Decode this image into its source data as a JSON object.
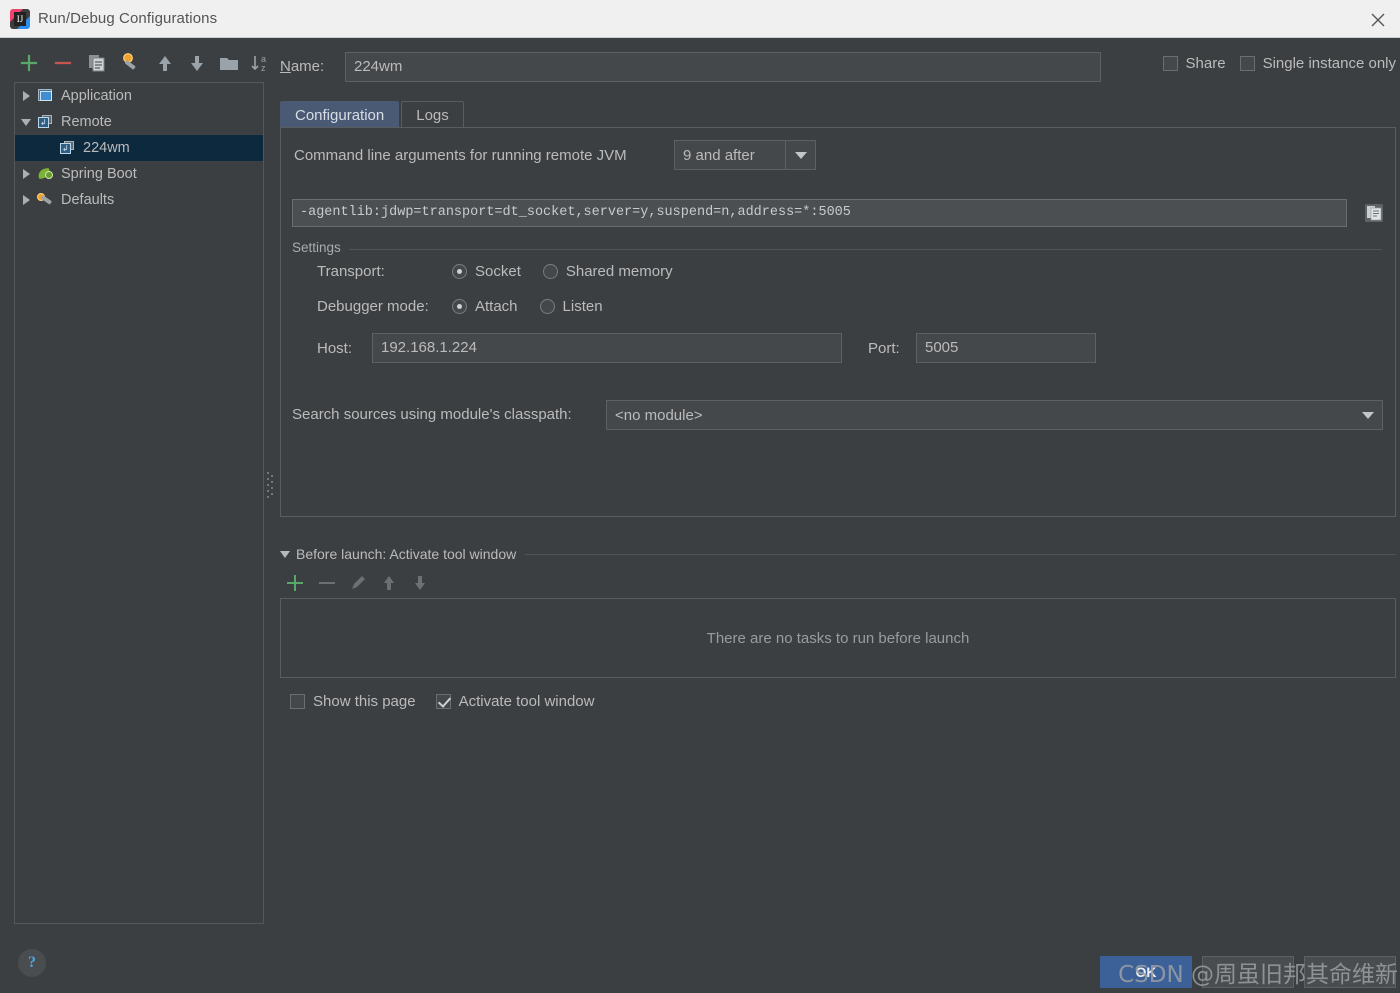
{
  "window": {
    "title": "Run/Debug Configurations",
    "app_icon": "intellij-idea-icon",
    "close_icon": "close-icon"
  },
  "left_toolbar": {
    "buttons": [
      {
        "name": "add-configuration-button",
        "icon": "plus-icon",
        "label": "+"
      },
      {
        "name": "remove-configuration-button",
        "icon": "minus-icon",
        "label": "-"
      },
      {
        "name": "copy-configuration-button",
        "icon": "copy-icon",
        "label": "Copy"
      },
      {
        "name": "edit-defaults-button",
        "icon": "wrench-icon",
        "label": "Edit defaults"
      },
      {
        "name": "move-up-button",
        "icon": "arrow-up-icon",
        "label": "Move Up"
      },
      {
        "name": "move-down-button",
        "icon": "arrow-down-icon",
        "label": "Move Down"
      },
      {
        "name": "new-folder-button",
        "icon": "folder-icon",
        "label": "New Folder"
      },
      {
        "name": "sort-button",
        "icon": "sort-alpha-icon",
        "label": "Sort Configurations"
      }
    ]
  },
  "tree": {
    "items": [
      {
        "label": "Application",
        "icon": "application-icon",
        "level": 1,
        "expanded": false,
        "selected": false
      },
      {
        "label": "Remote",
        "icon": "remote-icon",
        "level": 1,
        "expanded": true,
        "selected": false
      },
      {
        "label": "224wm",
        "icon": "remote-icon",
        "level": 2,
        "expanded": null,
        "selected": true
      },
      {
        "label": "Spring Boot",
        "icon": "spring-boot-icon",
        "level": 1,
        "expanded": false,
        "selected": false
      },
      {
        "label": "Defaults",
        "icon": "wrench-icon",
        "level": 1,
        "expanded": false,
        "selected": false
      }
    ]
  },
  "header": {
    "name_label": "Name:",
    "name_value": "224wm",
    "share_label": "Share",
    "share_checked": false,
    "single_instance_label": "Single instance only",
    "single_instance_checked": false
  },
  "tabs": [
    {
      "label": "Configuration",
      "active": true
    },
    {
      "label": "Logs",
      "active": false
    }
  ],
  "configuration": {
    "cmdline_label": "Command line arguments for running remote JVM",
    "jdk_combo_value": "9 and after",
    "jvm_args": "-agentlib:jdwp=transport=dt_socket,server=y,suspend=n,address=*:5005",
    "copy_icon": "copy-to-clipboard-icon",
    "settings_group_title": "Settings",
    "transport_label": "Transport:",
    "transport_options": [
      {
        "label": "Socket",
        "selected": true
      },
      {
        "label": "Shared memory",
        "selected": false
      }
    ],
    "debugger_mode_label": "Debugger mode:",
    "debugger_mode_options": [
      {
        "label": "Attach",
        "selected": true
      },
      {
        "label": "Listen",
        "selected": false
      }
    ],
    "host_label": "Host:",
    "host_value": "192.168.1.224",
    "port_label": "Port:",
    "port_value": "5005",
    "module_label": "Search sources using module's classpath:",
    "module_value": "<no module>"
  },
  "before_launch": {
    "title": "Before launch: Activate tool window",
    "toolbar": [
      {
        "name": "add-task-button",
        "icon": "plus-icon"
      },
      {
        "name": "remove-task-button",
        "icon": "minus-icon"
      },
      {
        "name": "edit-task-button",
        "icon": "pencil-icon"
      },
      {
        "name": "move-task-up-button",
        "icon": "arrow-up-icon"
      },
      {
        "name": "move-task-down-button",
        "icon": "arrow-down-icon"
      }
    ],
    "empty_text": "There are no tasks to run before launch",
    "show_page_label": "Show this page",
    "show_page_checked": false,
    "activate_tool_window_label": "Activate tool window",
    "activate_tool_window_checked": true
  },
  "footer": {
    "help_label": "?",
    "buttons": [
      {
        "label": "OK",
        "primary": true
      },
      {
        "label": "Cancel",
        "primary": false
      },
      {
        "label": "Apply",
        "primary": false
      }
    ],
    "watermark": "CSDN @周虽旧邦其命维新"
  },
  "colors": {
    "background": "#3c3f41",
    "field_background": "#45484a",
    "selection": "#0d293e",
    "tab_active": "#4a5a75",
    "primary_button": "#3c6098",
    "text": "#bbbbbb",
    "titlebar": "#f0f0f0"
  }
}
